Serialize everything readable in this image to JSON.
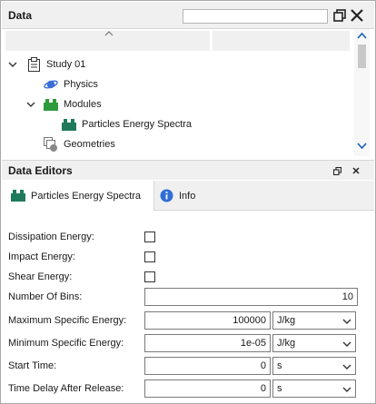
{
  "data_panel": {
    "title": "Data",
    "search": {
      "value": "",
      "placeholder": ""
    }
  },
  "tree": {
    "items": [
      {
        "label": "Study 01",
        "icon": "clipboard-icon",
        "expanded": true
      },
      {
        "label": "Physics",
        "icon": "physics-planet-icon"
      },
      {
        "label": "Modules",
        "icon": "modules-icon",
        "expanded": true
      },
      {
        "label": "Particles Energy Spectra",
        "icon": "module-block-icon"
      },
      {
        "label": "Geometries",
        "icon": "geometries-icon"
      }
    ]
  },
  "editors_panel": {
    "title": "Data Editors",
    "tabs": [
      {
        "label": "Particles Energy Spectra",
        "icon": "module-block-icon",
        "active": true
      },
      {
        "label": "Info",
        "icon": "info-icon",
        "active": false
      }
    ]
  },
  "form": {
    "dissipation_energy": {
      "label": "Dissipation Energy:",
      "checked": false
    },
    "impact_energy": {
      "label": "Impact Energy:",
      "checked": false
    },
    "shear_energy": {
      "label": "Shear Energy:",
      "checked": false
    },
    "number_of_bins": {
      "label": "Number Of Bins:",
      "value": "10"
    },
    "max_specific_energy": {
      "label": "Maximum Specific Energy:",
      "value": "100000",
      "unit": "J/kg"
    },
    "min_specific_energy": {
      "label": "Minimum Specific Energy:",
      "value": "1e-05",
      "unit": "J/kg"
    },
    "start_time": {
      "label": "Start Time:",
      "value": "0",
      "unit": "s"
    },
    "time_delay": {
      "label": "Time Delay After Release:",
      "value": "0",
      "unit": "s"
    }
  },
  "colors": {
    "module_green": "#1e7a5a",
    "physics_blue": "#3a6fd8",
    "info_blue": "#2f6fd6",
    "scroll_arrow": "#1a5fb4"
  }
}
